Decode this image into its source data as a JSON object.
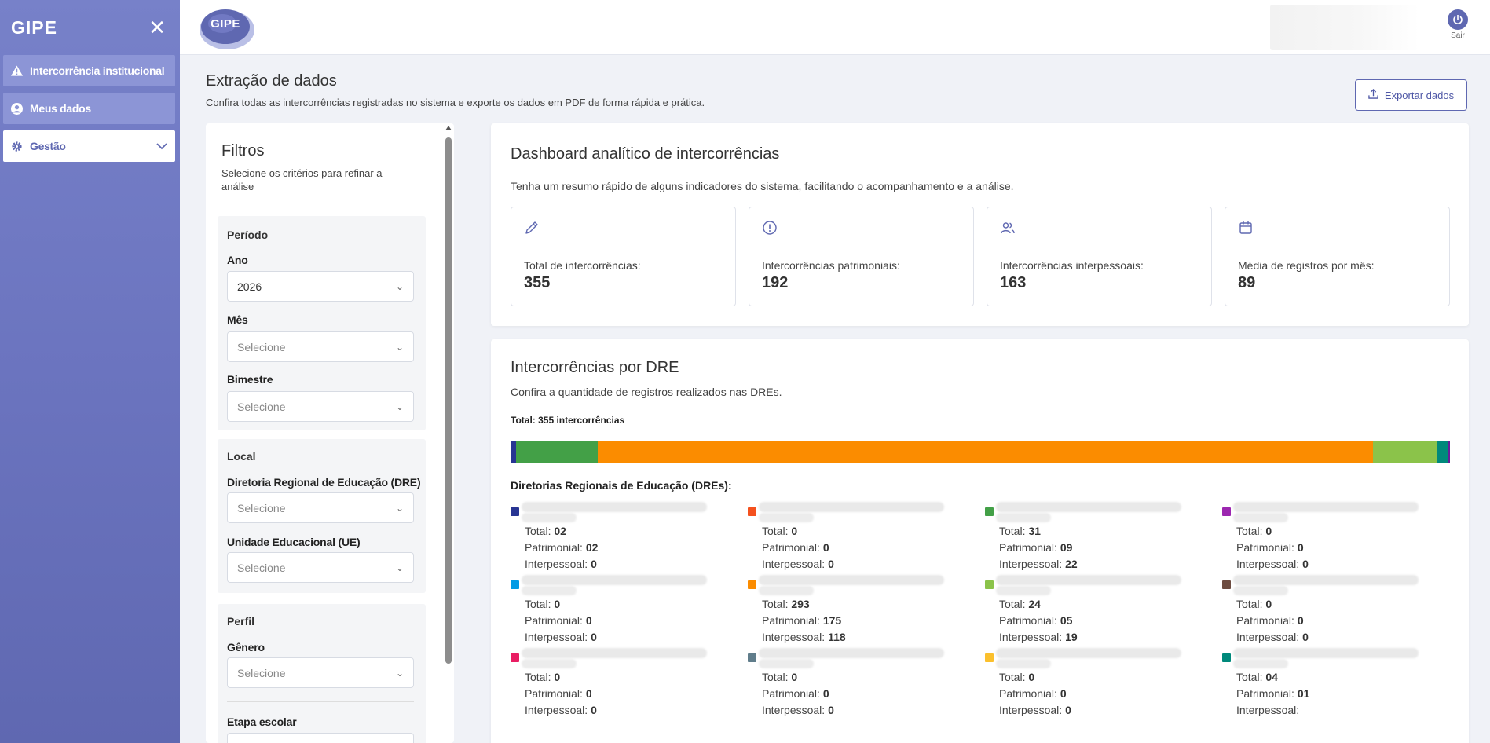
{
  "sidebar": {
    "logo": "GIPE",
    "items": [
      {
        "label": "Intercorrência institucional",
        "icon": "warning-icon"
      },
      {
        "label": "Meus dados",
        "icon": "user-circle-icon"
      },
      {
        "label": "Gestão",
        "icon": "gear-icon",
        "expanded": false
      }
    ]
  },
  "header": {
    "logo": "GIPE",
    "logout_label": "Sair"
  },
  "page": {
    "title": "Extração de dados",
    "subtitle": "Confira todas as intercorrências registradas no sistema e exporte os dados em PDF de forma rápida e prática.",
    "export_label": "Exportar dados"
  },
  "filters": {
    "title": "Filtros",
    "subtitle": "Selecione os critérios para refinar a análise",
    "periodo": {
      "title": "Período",
      "ano_label": "Ano",
      "ano_value": "2026",
      "mes_label": "Mês",
      "mes_placeholder": "Selecione",
      "bimestre_label": "Bimestre",
      "bimestre_placeholder": "Selecione"
    },
    "local": {
      "title": "Local",
      "dre_label": "Diretoria Regional de Educação (DRE)",
      "dre_placeholder": "Selecione",
      "ue_label": "Unidade Educacional (UE)",
      "ue_placeholder": "Selecione"
    },
    "perfil": {
      "title": "Perfil",
      "genero_label": "Gênero",
      "genero_placeholder": "Selecione",
      "etapa_label": "Etapa escolar"
    }
  },
  "dashboard": {
    "title": "Dashboard analítico de intercorrências",
    "subtitle": "Tenha um resumo rápido de alguns indicadores do sistema, facilitando o acompanhamento e a análise.",
    "stats": [
      {
        "label": "Total de intercorrências:",
        "value": "355",
        "icon": "pencil-icon"
      },
      {
        "label": "Intercorrências patrimoniais:",
        "value": "192",
        "icon": "alert-circle-icon"
      },
      {
        "label": "Intercorrências interpessoais:",
        "value": "163",
        "icon": "users-icon"
      },
      {
        "label": "Média de registros por mês:",
        "value": "89",
        "icon": "calendar-icon"
      }
    ]
  },
  "dre_section": {
    "title": "Intercorrências por DRE",
    "subtitle": "Confira a quantidade de registros realizados nas DREs.",
    "total_label": "Total: 355 intercorrências",
    "list_title": "Diretorias Regionais de Educação (DREs):",
    "total_prefix": "Total:",
    "patrimonial_prefix": "Patrimonial:",
    "interpessoal_prefix": "Interpessoal:",
    "bar_total": 355,
    "items": [
      {
        "color": "#283593",
        "total": "02",
        "patrimonial": "02",
        "interpessoal": "0"
      },
      {
        "color": "#f4511e",
        "total": "0",
        "patrimonial": "0",
        "interpessoal": "0"
      },
      {
        "color": "#43a047",
        "total": "31",
        "patrimonial": "09",
        "interpessoal": "22"
      },
      {
        "color": "#9c27b0",
        "total": "0",
        "patrimonial": "0",
        "interpessoal": "0"
      },
      {
        "color": "#039be5",
        "total": "0",
        "patrimonial": "0",
        "interpessoal": "0"
      },
      {
        "color": "#fb8c00",
        "total": "293",
        "patrimonial": "175",
        "interpessoal": "118"
      },
      {
        "color": "#8bc34a",
        "total": "24",
        "patrimonial": "05",
        "interpessoal": "19"
      },
      {
        "color": "#6d4c41",
        "total": "0",
        "patrimonial": "0",
        "interpessoal": "0"
      },
      {
        "color": "#e91e63",
        "total": "0",
        "patrimonial": "0",
        "interpessoal": "0"
      },
      {
        "color": "#607d8b",
        "total": "0",
        "patrimonial": "0",
        "interpessoal": "0"
      },
      {
        "color": "#fbc02d",
        "total": "0",
        "patrimonial": "0",
        "interpessoal": "0"
      },
      {
        "color": "#00897b",
        "total": "04",
        "patrimonial": "01",
        "interpessoal": ""
      }
    ],
    "bar_segments": [
      {
        "color": "#283593",
        "value": 2
      },
      {
        "color": "#43a047",
        "value": 31
      },
      {
        "color": "#fb8c00",
        "value": 293
      },
      {
        "color": "#8bc34a",
        "value": 24
      },
      {
        "color": "#00897b",
        "value": 4
      },
      {
        "color": "#6a1b9a",
        "value": 1
      }
    ]
  }
}
